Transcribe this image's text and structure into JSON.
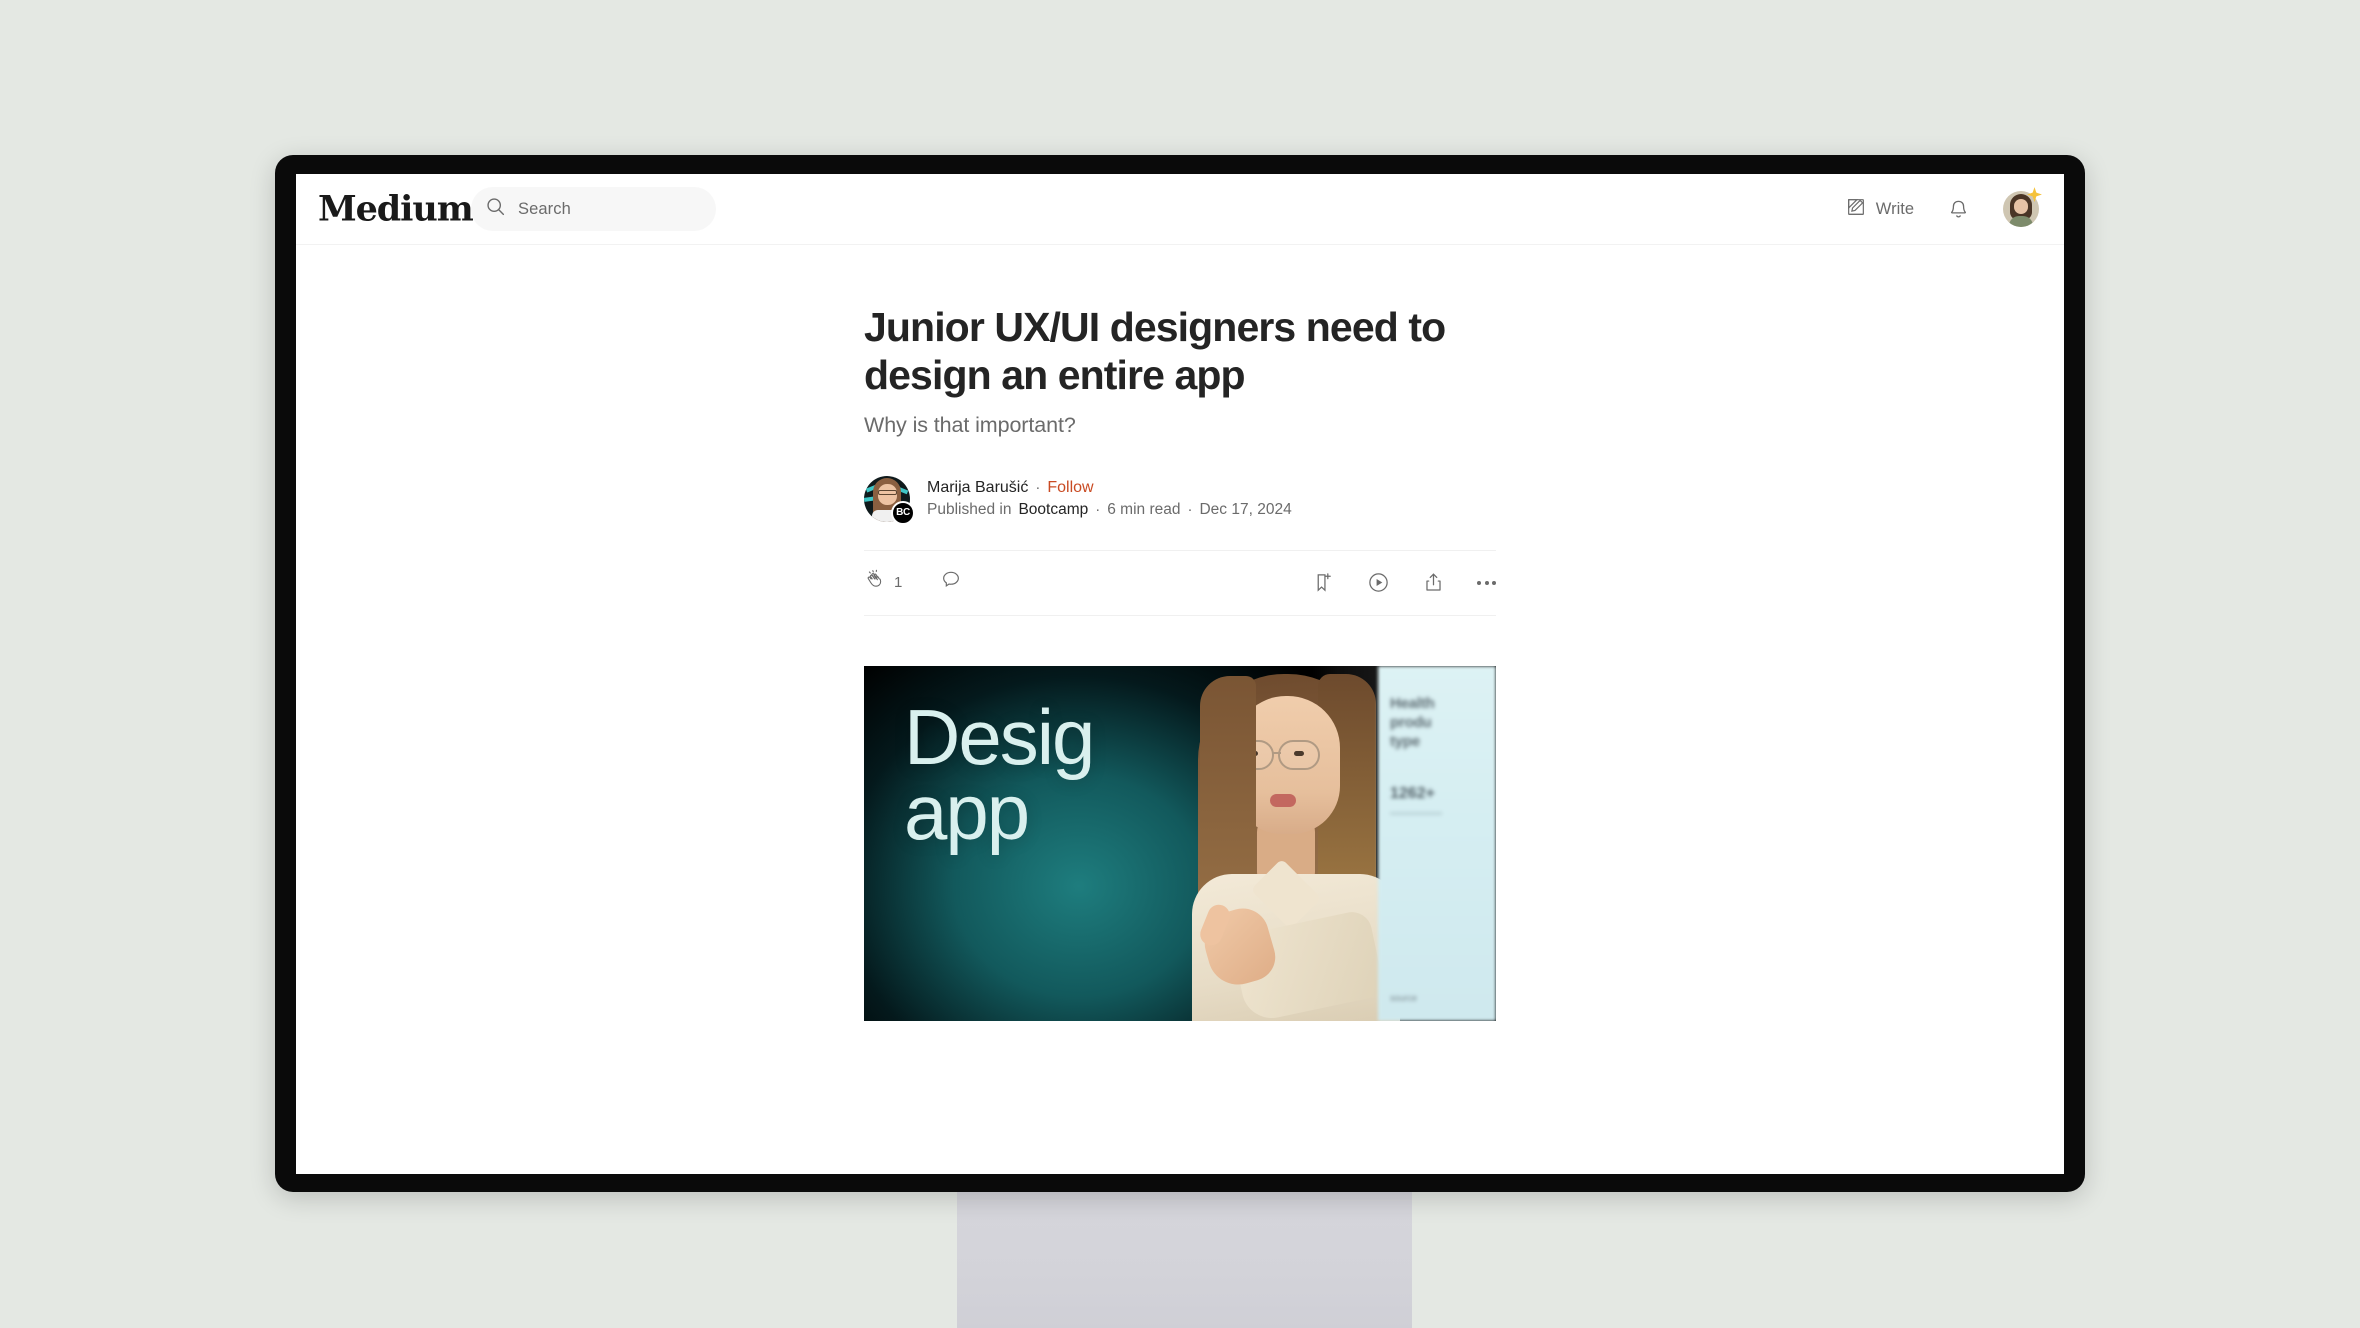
{
  "header": {
    "brand": "Medium",
    "search": {
      "placeholder": "Search",
      "value": "",
      "icon": "search-icon"
    },
    "write_label": "Write",
    "write_icon": "write-pencil-icon",
    "bell_icon": "notifications-bell-icon",
    "avatar_icon": "user-avatar",
    "avatar_badge_icon": "member-star-badge"
  },
  "article": {
    "title": "Junior UX/UI designers need to design an entire app",
    "subtitle": "Why is that important?",
    "author": {
      "name": "Marija Barušić",
      "follow_label": "Follow",
      "follow_color": "#c94b23",
      "separator": "·",
      "publication_badge": "BC"
    },
    "meta": {
      "published_prefix": "Published in",
      "publication": "Bootcamp",
      "read_time": "6 min read",
      "date": "Dec 17, 2024",
      "separator": "·"
    },
    "actions": {
      "clap": {
        "icon": "clap-icon",
        "count": "1"
      },
      "comment": {
        "icon": "comment-bubble-icon"
      },
      "bookmark": {
        "icon": "bookmark-add-icon"
      },
      "listen": {
        "icon": "play-circle-icon"
      },
      "share": {
        "icon": "share-icon"
      },
      "more": {
        "icon": "more-options-icon"
      }
    },
    "hero": {
      "overlay_line1": "Desig",
      "overlay_line2": "app",
      "panel_line1": "Health",
      "panel_line2": "produ",
      "panel_line3": "type",
      "panel_stat": "1262+",
      "panel_foot": "source"
    }
  }
}
